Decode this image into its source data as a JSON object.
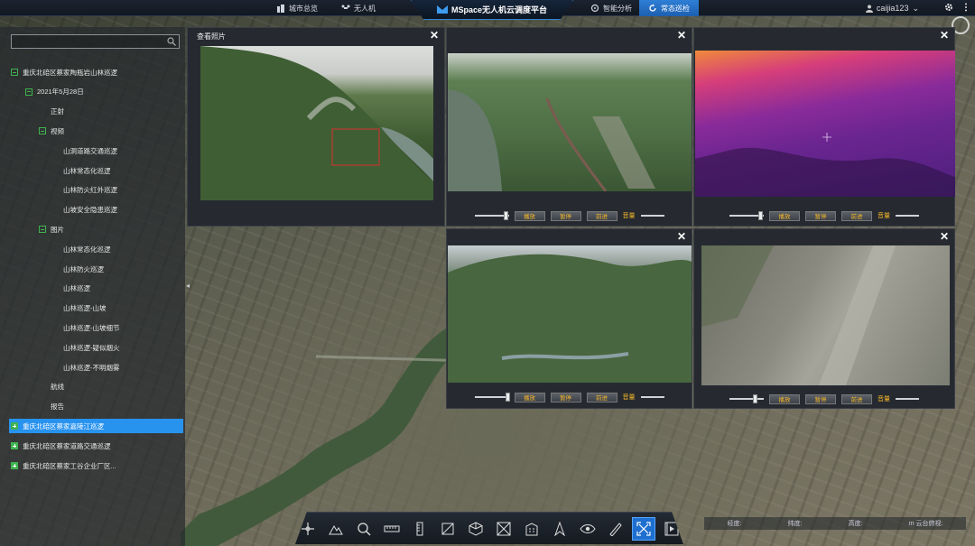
{
  "topbar": {
    "tabs": [
      {
        "label": "城市总览",
        "active": false
      },
      {
        "label": "无人机",
        "active": false
      },
      {
        "label": "智能分析",
        "active": false
      },
      {
        "label": "常态巡检",
        "active": true
      }
    ],
    "app_title": "MSpace无人机云调度平台",
    "user": "caijia123"
  },
  "sidebar": {
    "search_placeholder": "",
    "tree": [
      {
        "label": "重庆北碚区蔡家陶瓶岩山林巡逻",
        "level": 0,
        "toggle": "minus"
      },
      {
        "label": "2021年5月28日",
        "level": 1,
        "toggle": "minus"
      },
      {
        "label": "正射",
        "level": 2,
        "toggle": "none"
      },
      {
        "label": "视频",
        "level": 2,
        "toggle": "minus"
      },
      {
        "label": "山洞道路交通巡逻",
        "level": 3,
        "toggle": "none"
      },
      {
        "label": "山林常态化巡逻",
        "level": 3,
        "toggle": "none"
      },
      {
        "label": "山林防火红外巡逻",
        "level": 3,
        "toggle": "none"
      },
      {
        "label": "山坡安全隐患巡逻",
        "level": 3,
        "toggle": "none"
      },
      {
        "label": "图片",
        "level": 2,
        "toggle": "minus"
      },
      {
        "label": "山林常态化巡逻",
        "level": 3,
        "toggle": "none"
      },
      {
        "label": "山林防火巡逻",
        "level": 3,
        "toggle": "none"
      },
      {
        "label": "山林巡逻",
        "level": 3,
        "toggle": "none"
      },
      {
        "label": "山林巡逻-山坡",
        "level": 3,
        "toggle": "none"
      },
      {
        "label": "山林巡逻-山坡细节",
        "level": 3,
        "toggle": "none"
      },
      {
        "label": "山林巡逻-疑似烟火",
        "level": 3,
        "toggle": "none"
      },
      {
        "label": "山林巡逻-不明烟雾",
        "level": 3,
        "toggle": "none"
      },
      {
        "label": "航线",
        "level": 2,
        "toggle": "none"
      },
      {
        "label": "报告",
        "level": 2,
        "toggle": "none"
      },
      {
        "label": "重庆北碚区蔡家嘉陵江巡逻",
        "level": 0,
        "toggle": "plus",
        "selected": true
      },
      {
        "label": "重庆北碚区蔡家道路交通巡逻",
        "level": 0,
        "toggle": "plus"
      },
      {
        "label": "重庆北碚区蔡家工谷企业厂区...",
        "level": 0,
        "toggle": "plus"
      }
    ]
  },
  "panels": {
    "photo_title": "查看照片",
    "close_glyph": "✕",
    "buttons": {
      "play": "播放",
      "pause": "暂停",
      "forward": "前进",
      "volume": "音量"
    }
  },
  "coords": {
    "lon": "经度:",
    "lat": "纬度:",
    "alt": "高度:",
    "cam": "m 云台俯视:"
  },
  "toolbar": {
    "tools": [
      "move-icon",
      "terrain-icon",
      "search-icon",
      "ruler-icon",
      "height-icon",
      "area-icon",
      "cube-icon",
      "frame-icon",
      "building-icon",
      "north-icon",
      "eye-icon",
      "pen-icon",
      "fullscreen-icon",
      "video-icon"
    ],
    "active_tool": "fullscreen-icon"
  },
  "colors": {
    "accent": "#2892ef",
    "toggle_green": "#3fb34f",
    "button_text": "#f2b62a"
  }
}
